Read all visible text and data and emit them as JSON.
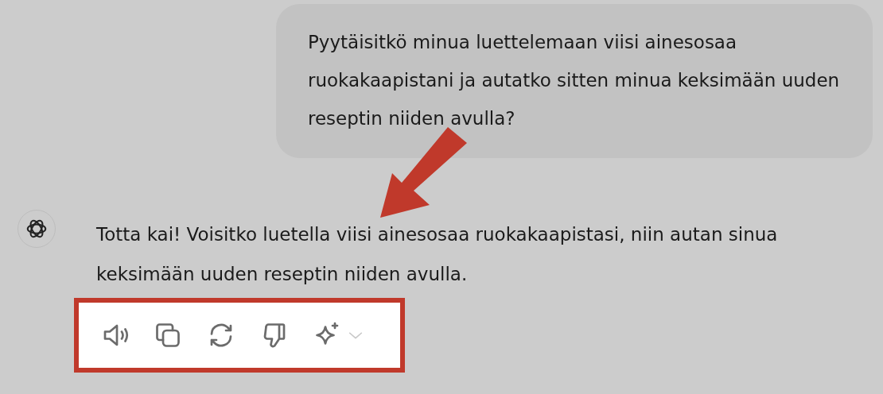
{
  "user_message": {
    "text": "Pyytäisitkö minua luettelemaan viisi ainesosaa ruokakaapistani ja autatko sitten minua keksimään uuden reseptin niiden avulla?"
  },
  "assistant_message": {
    "text": "Totta kai! Voisitko luetella viisi ainesosaa ruokakaapistasi, niin autan sinua keksimään uuden reseptin niiden avulla.",
    "actions": [
      {
        "kind": "read_aloud"
      },
      {
        "kind": "copy"
      },
      {
        "kind": "regenerate"
      },
      {
        "kind": "dislike"
      },
      {
        "kind": "model"
      }
    ]
  }
}
